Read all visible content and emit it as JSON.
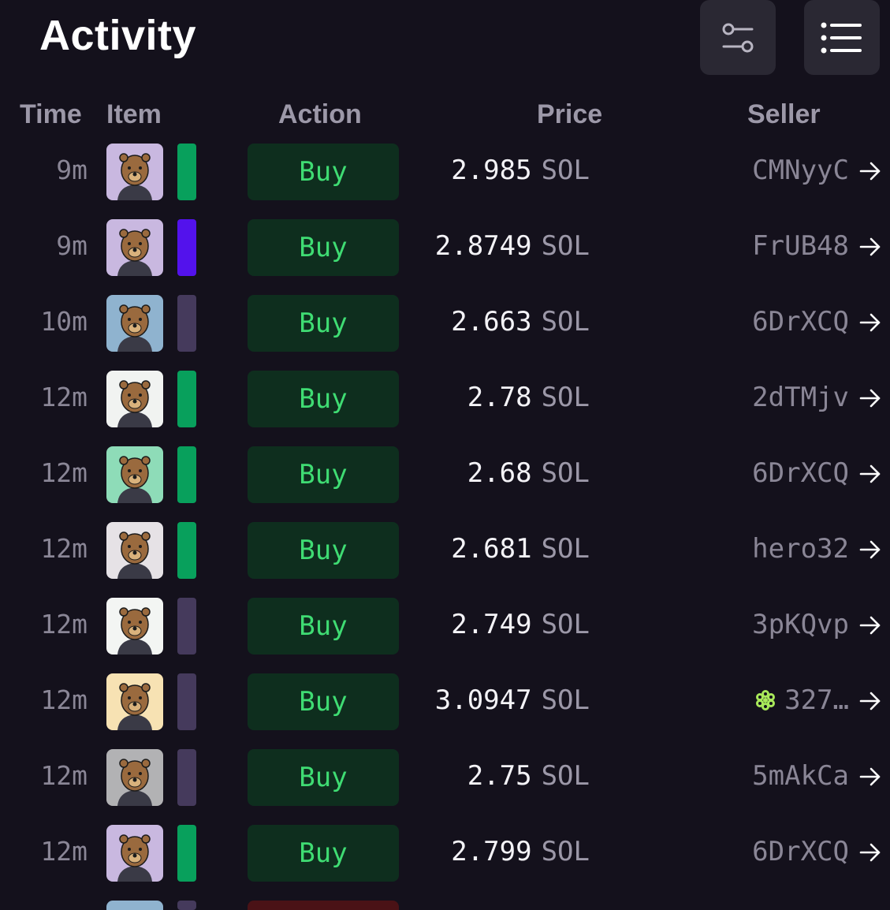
{
  "page": {
    "title": "Activity"
  },
  "toolbar": {
    "filter_icon": "filter-sliders-icon",
    "list_icon": "list-view-icon"
  },
  "columns": {
    "time": "Time",
    "item": "Item",
    "action": "Action",
    "price": "Price",
    "seller": "Seller"
  },
  "colors": {
    "accent_green": "#3fdc73",
    "buy_bg": "#0e2e1e",
    "rarity_green": "#08a05c",
    "rarity_purple": "#5312ec",
    "rarity_muted": "#453a5c"
  },
  "rows": [
    {
      "time": "9m",
      "item_bg": "#c9b8e0",
      "rarity": "#08a05c",
      "action": "Buy",
      "price": "2.985",
      "currency": "SOL",
      "seller": "CMNyyC",
      "seller_badge": false
    },
    {
      "time": "9m",
      "item_bg": "#c9b8e0",
      "rarity": "#5312ec",
      "action": "Buy",
      "price": "2.8749",
      "currency": "SOL",
      "seller": "FrUB48",
      "seller_badge": false
    },
    {
      "time": "10m",
      "item_bg": "#8fb3cf",
      "rarity": "#453a5c",
      "action": "Buy",
      "price": "2.663",
      "currency": "SOL",
      "seller": "6DrXCQ",
      "seller_badge": false
    },
    {
      "time": "12m",
      "item_bg": "#f1f3f1",
      "rarity": "#08a05c",
      "action": "Buy",
      "price": "2.78",
      "currency": "SOL",
      "seller": "2dTMjv",
      "seller_badge": false
    },
    {
      "time": "12m",
      "item_bg": "#8edcb8",
      "rarity": "#08a05c",
      "action": "Buy",
      "price": "2.68",
      "currency": "SOL",
      "seller": "6DrXCQ",
      "seller_badge": false
    },
    {
      "time": "12m",
      "item_bg": "#e6e2e6",
      "rarity": "#08a05c",
      "action": "Buy",
      "price": "2.681",
      "currency": "SOL",
      "seller": "hero32",
      "seller_badge": false
    },
    {
      "time": "12m",
      "item_bg": "#f3f5f3",
      "rarity": "#453a5c",
      "action": "Buy",
      "price": "2.749",
      "currency": "SOL",
      "seller": "3pKQvp",
      "seller_badge": false
    },
    {
      "time": "12m",
      "item_bg": "#f7e2b3",
      "rarity": "#453a5c",
      "action": "Buy",
      "price": "3.0947",
      "currency": "SOL",
      "seller": "327…",
      "seller_badge": true
    },
    {
      "time": "12m",
      "item_bg": "#b2b2b4",
      "rarity": "#453a5c",
      "action": "Buy",
      "price": "2.75",
      "currency": "SOL",
      "seller": "5mAkCa",
      "seller_badge": false
    },
    {
      "time": "12m",
      "item_bg": "#c9b8e0",
      "rarity": "#08a05c",
      "action": "Buy",
      "price": "2.799",
      "currency": "SOL",
      "seller": "6DrXCQ",
      "seller_badge": false
    }
  ]
}
